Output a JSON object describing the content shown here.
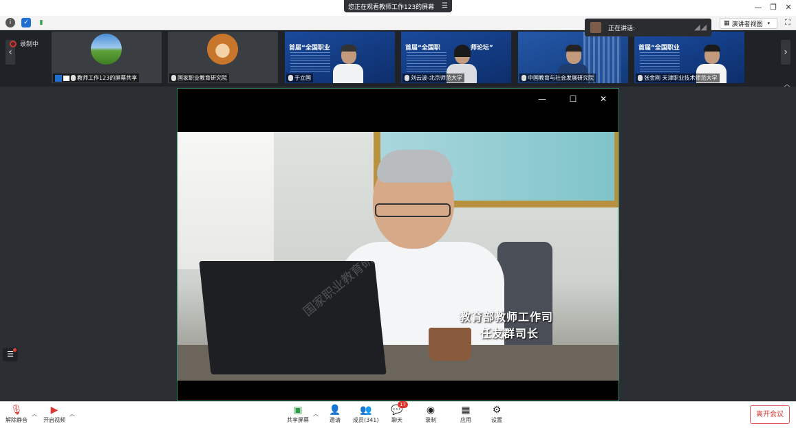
{
  "title_bar": {
    "share_banner": "您正在观看教师工作123的屏幕",
    "minimize_glyph": "—",
    "restore_glyph": "❐",
    "close_glyph": "✕"
  },
  "toolbar": {
    "view_label": "演讲者视图",
    "speaking_label": "正在讲话:"
  },
  "strip": {
    "recording_label": "录制中",
    "tiles": [
      {
        "name": "教师工作123的屏幕共享"
      },
      {
        "name": "国家职业教育研究院"
      },
      {
        "name": "于立国",
        "slide_title": "首届“全国职业"
      },
      {
        "name": "刘云波-北京师范大学",
        "slide_title": "首届“全国职",
        "slide_title2": "师论坛”"
      },
      {
        "name": "中国教育与社会发展研究院"
      },
      {
        "name": "张金刚 天津职业技术师范大学",
        "slide_title": "首届“全国职业"
      }
    ]
  },
  "main": {
    "caption_line1": "教育部教师工作司",
    "caption_line2": "任友群司长",
    "watermark": "国家职业教育研"
  },
  "bottom": {
    "unmute": "解除静音",
    "start_video": "开启视频",
    "share_screen": "共享屏幕",
    "invite": "邀请",
    "members": "成员(341)",
    "chat": "聊天",
    "chat_badge": "17",
    "record": "录制",
    "apps": "应用",
    "settings": "设置",
    "leave": "离开会议"
  },
  "colors": {
    "accent_green": "#2e8b6e",
    "leave_red": "#d83b36"
  }
}
